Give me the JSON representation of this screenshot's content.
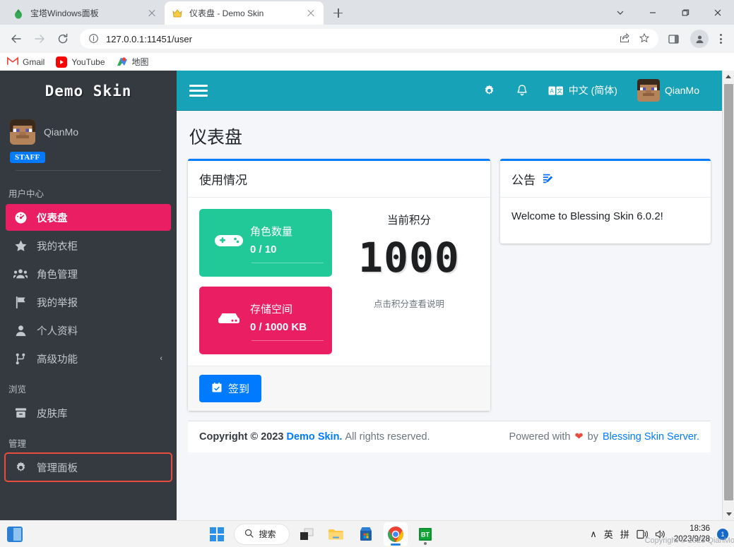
{
  "browser": {
    "tabs": [
      {
        "title": "宝塔Windows面板",
        "favicon": "bt-panel-icon",
        "active": false
      },
      {
        "title": "仪表盘 - Demo Skin",
        "favicon": "crown-icon",
        "active": true
      }
    ],
    "new_tab_label": "+",
    "window_controls": [
      "chevron-down",
      "minimize",
      "maximize",
      "close"
    ],
    "url": "127.0.0.1:11451/user",
    "bookmarks": [
      {
        "label": "Gmail",
        "icon": "gmail-icon"
      },
      {
        "label": "YouTube",
        "icon": "youtube-icon"
      },
      {
        "label": "地图",
        "icon": "maps-icon"
      }
    ]
  },
  "sidebar": {
    "brand": "Demo Skin",
    "user": {
      "name": "QianMo",
      "badge": "STAFF"
    },
    "sections": [
      {
        "header": "用户中心",
        "items": [
          {
            "label": "仪表盘",
            "icon": "dashboard-icon",
            "active": true
          },
          {
            "label": "我的衣柜",
            "icon": "star-icon",
            "active": false
          },
          {
            "label": "角色管理",
            "icon": "users-icon",
            "active": false
          },
          {
            "label": "我的举报",
            "icon": "flag-icon",
            "active": false
          },
          {
            "label": "个人资料",
            "icon": "user-icon",
            "active": false
          },
          {
            "label": "高级功能",
            "icon": "sitemap-icon",
            "active": false,
            "arrow": "‹"
          }
        ]
      },
      {
        "header": "浏览",
        "items": [
          {
            "label": "皮肤库",
            "icon": "archive-icon",
            "active": false
          }
        ]
      },
      {
        "header": "管理",
        "items": [
          {
            "label": "管理面板",
            "icon": "gear-icon",
            "active": false,
            "highlighted": true
          }
        ]
      }
    ]
  },
  "navbar": {
    "menu_icon": "hamburger-icon",
    "items": [
      {
        "icon": "gear-icon",
        "label": ""
      },
      {
        "icon": "bell-icon",
        "label": ""
      },
      {
        "icon": "language-icon",
        "label": "中文 (简体)"
      }
    ],
    "user": "QianMo"
  },
  "main": {
    "page_title": "仪表盘",
    "usage_card": {
      "title": "使用情况",
      "boxes": [
        {
          "label": "角色数量",
          "value": "0 / 10",
          "icon": "gamepad-icon",
          "color": "#20c997"
        },
        {
          "label": "存储空间",
          "value": "0 / 1000 KB",
          "icon": "hdd-icon",
          "color": "#e91e63"
        }
      ],
      "score": {
        "label": "当前积分",
        "value": "1000",
        "hint": "点击积分查看说明"
      },
      "sign_button": {
        "label": "签到",
        "icon": "calendar-check-icon"
      }
    },
    "announcement_card": {
      "title": "公告",
      "edit_icon": "edit-icon",
      "body": "Welcome to Blessing Skin 6.0.2!"
    }
  },
  "footer": {
    "copyright_prefix": "Copyright © 2023",
    "site_name": "Demo Skin.",
    "rights": "All rights reserved.",
    "powered_prefix": "Powered with",
    "heart": "❤",
    "by": "by",
    "engine": "Blessing Skin Server."
  },
  "taskbar": {
    "widgets_icon": "widgets-icon",
    "start_icon": "windows-start-icon",
    "search_placeholder": "搜索",
    "apps": [
      {
        "name": "task-view-icon"
      },
      {
        "name": "file-explorer-icon"
      },
      {
        "name": "microsoft-store-icon"
      },
      {
        "name": "chrome-icon",
        "active": true
      },
      {
        "name": "bt-panel-icon",
        "running": true
      }
    ],
    "tray": {
      "chevron": "∧",
      "ime_lang": "英",
      "ime_mode": "拼",
      "device_icon": "cast-icon",
      "volume_icon": "volume-icon"
    },
    "clock": {
      "time": "18:36",
      "date": "2023/9/28"
    },
    "watermark": "Copyright © 2023 QianMo.",
    "notification_count": "1"
  },
  "colors": {
    "accent_teal": "#17a2b8",
    "accent_pink": "#e91e63",
    "accent_green": "#20c997",
    "accent_blue": "#007bff",
    "sidebar_bg": "#343a40"
  }
}
